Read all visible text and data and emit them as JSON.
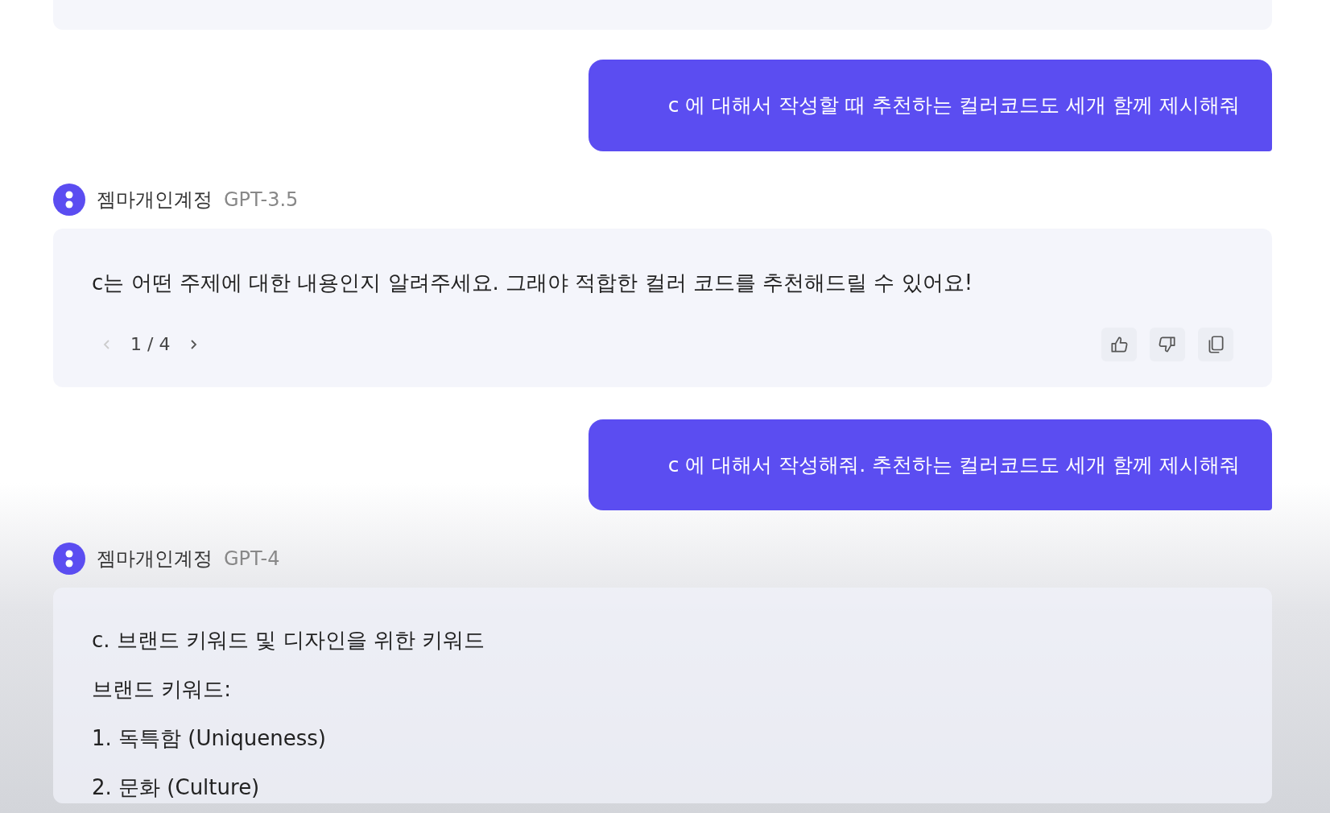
{
  "messages": [
    {
      "kind": "user",
      "text": "c 에 대해서 작성할 때 추천하는 컬러코드도 세개 함께 제시해줘"
    },
    {
      "kind": "assistant",
      "name": "젬마개인계정",
      "model": "GPT-3.5",
      "paragraphs": [
        "c는 어떤 주제에 대한 내용인지 알려주세요. 그래야 적합한 컬러 코드를 추천해드릴 수 있어요!"
      ],
      "pager": {
        "text": "1 / 4",
        "prev_disabled": true,
        "next_disabled": false
      },
      "actions": [
        {
          "kind": "like"
        },
        {
          "kind": "dislike"
        },
        {
          "kind": "copy"
        }
      ]
    },
    {
      "kind": "user",
      "text": "c 에 대해서 작성해줘. 추천하는 컬러코드도 세개 함께 제시해줘"
    },
    {
      "kind": "assistant",
      "name": "젬마개인계정",
      "model": "GPT-4",
      "paragraphs": [
        "c. 브랜드 키워드 및 디자인을 위한 키워드",
        "브랜드 키워드:",
        "1. 독특함 (Uniqueness)",
        "2. 문화 (Culture)"
      ]
    }
  ]
}
